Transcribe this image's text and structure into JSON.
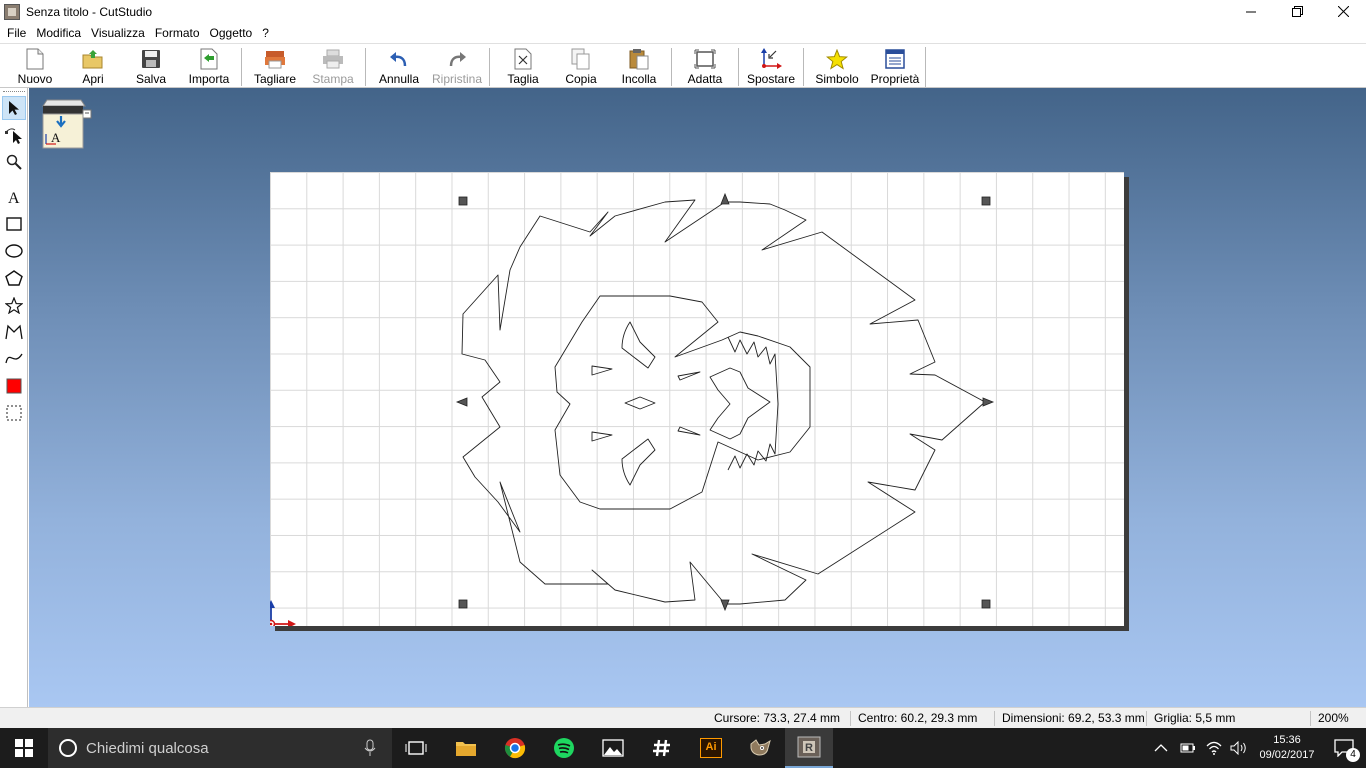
{
  "window": {
    "title": "Senza titolo - CutStudio"
  },
  "menu": [
    "File",
    "Modifica",
    "Visualizza",
    "Formato",
    "Oggetto",
    "?"
  ],
  "toolbar": {
    "nuovo": "Nuovo",
    "apri": "Apri",
    "salva": "Salva",
    "importa": "Importa",
    "tagliare": "Tagliare",
    "stampa": "Stampa",
    "annulla": "Annulla",
    "ripristina": "Ripristina",
    "taglia": "Taglia",
    "copia": "Copia",
    "incolla": "Incolla",
    "adatta": "Adatta",
    "spostare": "Spostare",
    "simbolo": "Simbolo",
    "proprieta": "Proprietà"
  },
  "status": {
    "cursore": "Cursore: 73.3, 27.4 mm",
    "centro": "Centro: 60.2, 29.3 mm",
    "dimensioni": "Dimensioni: 69.2, 53.3 mm",
    "griglia": "Griglia: 5,5 mm",
    "zoom": "200%"
  },
  "taskbar": {
    "search_placeholder": "Chiedimi qualcosa",
    "time": "15:36",
    "date": "09/02/2017",
    "notifications": "4",
    "ai_label": "Ai"
  },
  "colors": {
    "accent_blue": "#1a6fc0",
    "fill_swatch": "#ff0000",
    "taskbar": "#1c1c1c"
  }
}
